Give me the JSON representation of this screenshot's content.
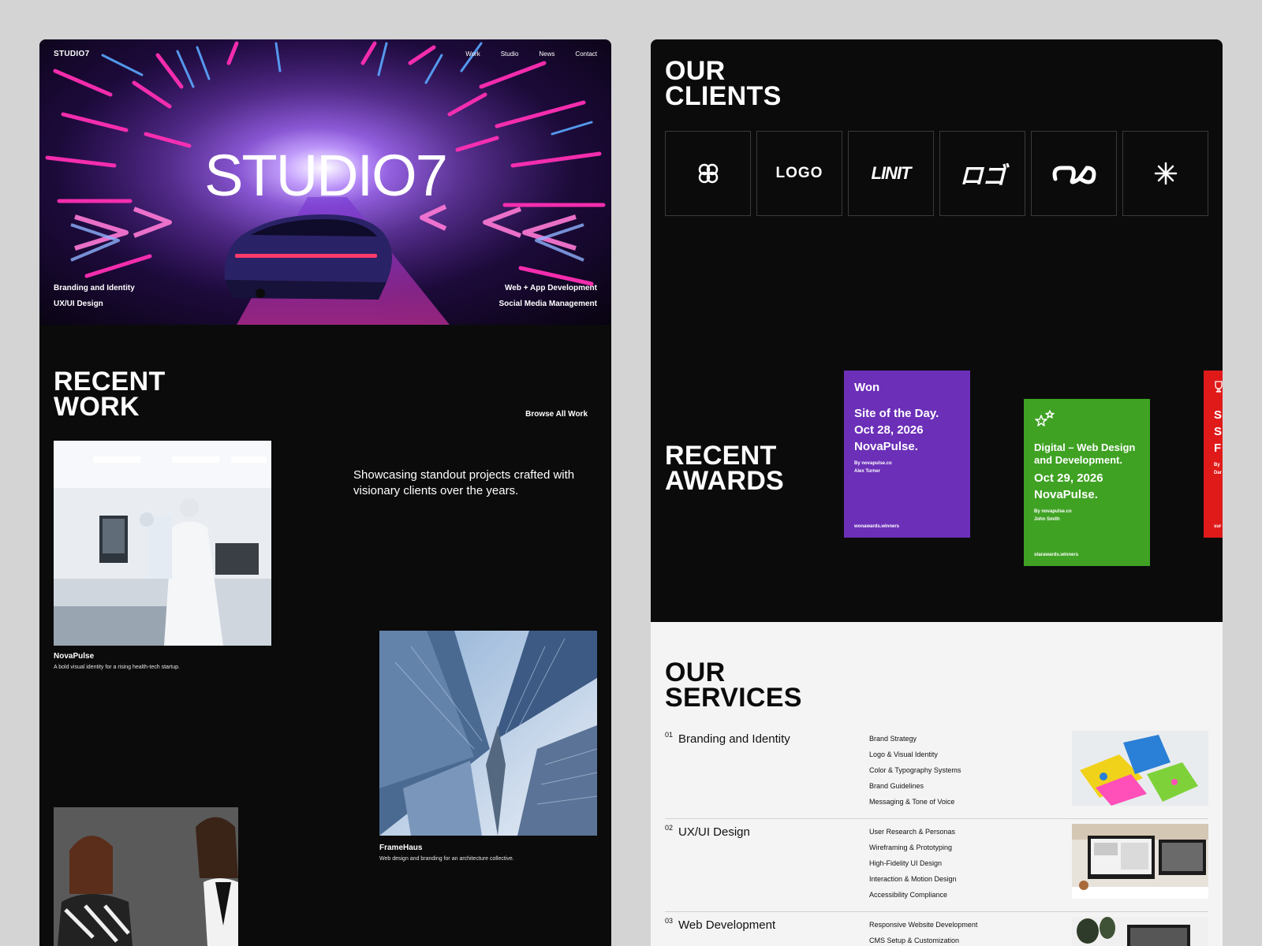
{
  "hero": {
    "brand": "STUDIO7",
    "nav": [
      "Work",
      "Studio",
      "News",
      "Contact"
    ],
    "title": "STUDIO7",
    "left_services": [
      "Branding and Identity",
      "UX/UI Design"
    ],
    "right_services": [
      "Web + App Development",
      "Social Media Management"
    ]
  },
  "recent_work": {
    "heading_line1": "RECENT",
    "heading_line2": "WORK",
    "browse_label": "Browse All Work",
    "intro": "Showcasing standout projects crafted with visionary clients over the years.",
    "projects": [
      {
        "name": "NovaPulse",
        "desc": "A bold visual identity for a rising health-tech startup."
      },
      {
        "name": "FrameHaus",
        "desc": "Web design and branding for an architecture collective."
      }
    ]
  },
  "clients": {
    "heading_line1": "OUR",
    "heading_line2": "CLIENTS",
    "logos": [
      "clover-icon",
      "LOGO",
      "Limit",
      "ロゴ",
      "infinity-icon",
      "asterisk-icon"
    ],
    "logo_text": {
      "logo2": "LOGO",
      "logo3": "LINIT",
      "logo4": "ロゴ"
    }
  },
  "awards": {
    "heading_line1": "RECENT",
    "heading_line2": "AWARDS",
    "cards": [
      {
        "label": "Won",
        "lines": [
          "Site of the Day.",
          "Oct 28, 2026",
          "NovaPulse."
        ],
        "by": [
          "By novapulse.co",
          "Alex Turner"
        ],
        "site": "wonawards.winners",
        "color": "#6b2fb8"
      },
      {
        "lines": [
          "Digital – Web Design",
          "and Development.",
          "Oct 29, 2026",
          "NovaPulse."
        ],
        "by": [
          "By novapulse.co",
          "John Smith"
        ],
        "site": "starawards.winners",
        "color": "#3fa223"
      },
      {
        "lines": [
          "S",
          "S",
          "F"
        ],
        "by": [
          "By",
          "Dar"
        ],
        "site": "sur",
        "color": "#e01919"
      }
    ]
  },
  "services": {
    "heading_line1": "OUR",
    "heading_line2": "SERVICES",
    "rows": [
      {
        "num": "01",
        "title": "Branding and Identity",
        "items": [
          "Brand Strategy",
          "Logo & Visual Identity",
          "Color & Typography Systems",
          "Brand Guidelines",
          "Messaging & Tone of Voice"
        ]
      },
      {
        "num": "02",
        "title": "UX/UI Design",
        "items": [
          "User Research & Personas",
          "Wireframing & Prototyping",
          "High-Fidelity UI Design",
          "Interaction & Motion Design",
          "Accessibility Compliance"
        ]
      },
      {
        "num": "03",
        "title": "Web Development",
        "items": [
          "Responsive Website Development",
          "CMS Setup & Customization"
        ]
      }
    ]
  },
  "colors": {
    "page_bg": "#d4d4d4",
    "panel_bg": "#0b0b0b",
    "services_bg": "#f4f4f4",
    "neon_pink": "#ff2fb4",
    "neon_blue": "#3a7bff"
  }
}
